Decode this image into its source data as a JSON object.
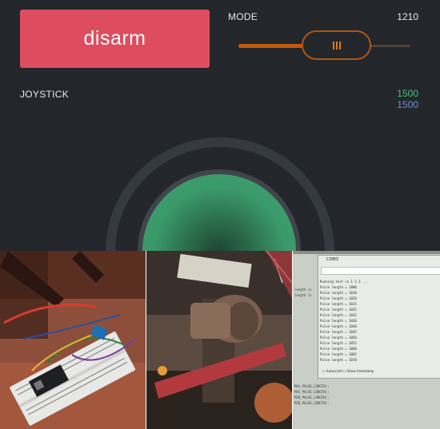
{
  "controls": {
    "disarm_label": "disarm",
    "mode_label": "MODE",
    "mode_value": "1210",
    "mode_slider_level": 0.44
  },
  "joystick": {
    "label": "JOYSTICK",
    "x_value": "1500",
    "y_value": "1500"
  },
  "colors": {
    "disarm": "#de4d5f",
    "slider": "#c2590f",
    "joystick_x": "#40c27d",
    "joystick_y": "#6f8fcf",
    "joystick_knob": "#3d9f6c"
  },
  "serial_monitor": {
    "title": "COM3",
    "header": "Running test in 1 2 3 ...",
    "lines": [
      "Pulse length = 1000",
      "Pulse length = 1010",
      "Pulse length = 1020",
      "Pulse length = 1015",
      "Pulse length = 1025",
      "Pulse length = 1035",
      "Pulse length = 1030",
      "Pulse length = 1040",
      "Pulse length = 1045",
      "Pulse length = 1050",
      "Pulse length = 1055",
      "Pulse length = 1060",
      "Pulse length = 1065",
      "Pulse length = 1070"
    ],
    "autoscroll_label": "Autoscroll",
    "timestamp_label": "Show timestamp",
    "side_code": [
      "length is",
      "length is"
    ],
    "bottom_code": [
      "MAX_PULSE_LENGTH);",
      "MAX_PULSE_LENGTH);",
      "MIN_PULSE_LENGTH);",
      "MIN_PULSE_LENGTH);"
    ]
  }
}
